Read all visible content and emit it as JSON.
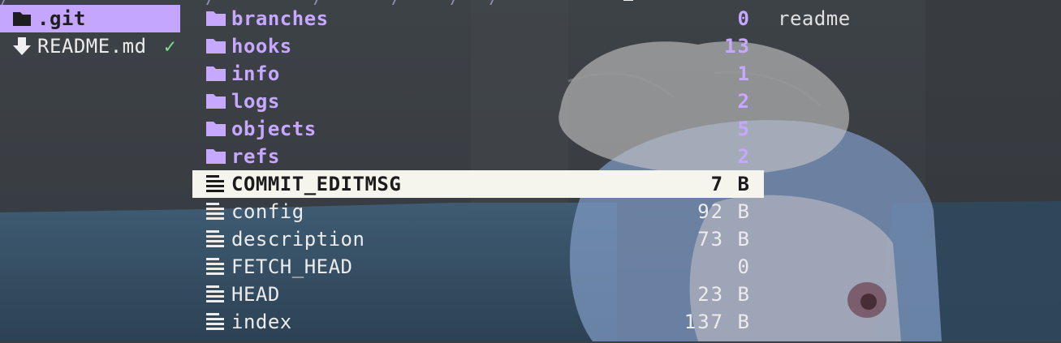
{
  "top_path": "/                    /          /       /     /   /          ",
  "parent_pane": {
    "items": [
      {
        "name": ".git",
        "type": "dir",
        "selected": true,
        "icon": "folder-icon"
      },
      {
        "name": "README.md",
        "type": "file",
        "selected": false,
        "icon": "download-arrow-icon",
        "status": "✓"
      }
    ]
  },
  "current_pane": {
    "items": [
      {
        "name": "branches",
        "size": "0",
        "type": "dir",
        "icon": "folder-icon"
      },
      {
        "name": "hooks",
        "size": "13",
        "type": "dir",
        "icon": "folder-icon"
      },
      {
        "name": "info",
        "size": "1",
        "type": "dir",
        "icon": "folder-icon"
      },
      {
        "name": "logs",
        "size": "2",
        "type": "dir",
        "icon": "folder-icon"
      },
      {
        "name": "objects",
        "size": "5",
        "type": "dir",
        "icon": "folder-icon"
      },
      {
        "name": "refs",
        "size": "2",
        "type": "dir",
        "icon": "folder-icon"
      },
      {
        "name": "COMMIT_EDITMSG",
        "size": "7 B",
        "type": "file",
        "selected": true,
        "icon": "text-file-icon"
      },
      {
        "name": "config",
        "size": "92 B",
        "type": "file",
        "icon": "text-file-icon"
      },
      {
        "name": "description",
        "size": "73 B",
        "type": "file",
        "icon": "text-file-icon"
      },
      {
        "name": "FETCH_HEAD",
        "size": "0",
        "type": "file",
        "icon": "text-file-icon"
      },
      {
        "name": "HEAD",
        "size": "23 B",
        "type": "file",
        "icon": "text-file-icon"
      },
      {
        "name": "index",
        "size": "137 B",
        "type": "file",
        "icon": "text-file-icon"
      }
    ]
  },
  "preview_pane": {
    "lines": [
      "readme"
    ]
  },
  "colors": {
    "dir": "#c6a8ff",
    "file": "#ececec",
    "parent_selection": "#c4a6ff",
    "file_selection": "#f5f5ee",
    "git_ok": "#7ee08a"
  }
}
